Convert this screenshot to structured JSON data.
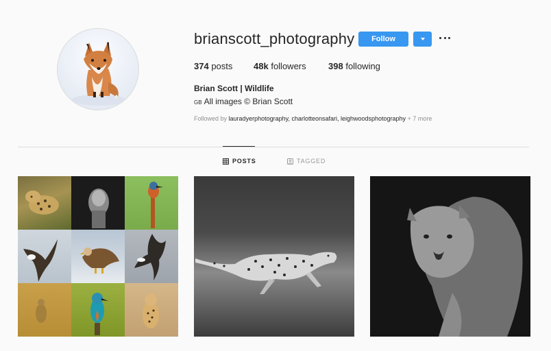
{
  "profile": {
    "username": "brianscott_photography",
    "follow_label": "Follow",
    "full_name": "Brian Scott | Wildlife",
    "bio_flag": "GB",
    "bio_text": "All images © Brian Scott",
    "followed_by_prefix": "Followed by",
    "followed_by_names": "lauradyerphotography, charlotteonsafari, leighwoodsphotography",
    "followed_by_more": "+ 7 more"
  },
  "stats": [
    {
      "value": "374",
      "label": "posts"
    },
    {
      "value": "48k",
      "label": "followers"
    },
    {
      "value": "398",
      "label": "following"
    }
  ],
  "tabs": [
    {
      "label": "POSTS",
      "active": true,
      "icon": "grid-icon"
    },
    {
      "label": "TAGGED",
      "active": false,
      "icon": "tagged-icon"
    }
  ],
  "colors": {
    "accent": "#3897f0",
    "text": "#262626",
    "muted": "#8e8e8e",
    "border": "#dbdbdb",
    "background": "#fafafa"
  }
}
